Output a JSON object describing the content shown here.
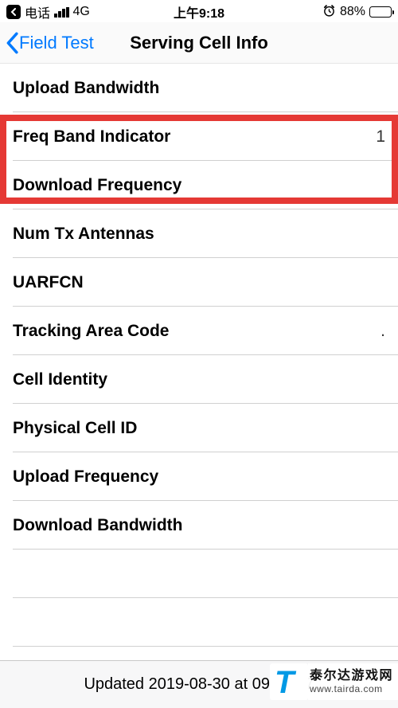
{
  "status": {
    "carrier": "电话",
    "network": "4G",
    "time": "上午9:18",
    "battery_pct": "88%"
  },
  "nav": {
    "back_label": "Field Test",
    "title": "Serving Cell Info"
  },
  "rows": [
    {
      "label": "Upload Bandwidth",
      "value": ""
    },
    {
      "label": "Freq Band Indicator",
      "value": "1"
    },
    {
      "label": "Download Frequency",
      "value": ""
    },
    {
      "label": "Num Tx Antennas",
      "value": ""
    },
    {
      "label": "UARFCN",
      "value": ""
    },
    {
      "label": "Tracking Area Code",
      "value": "."
    },
    {
      "label": "Cell Identity",
      "value": ""
    },
    {
      "label": "Physical Cell ID",
      "value": ""
    },
    {
      "label": "Upload Frequency",
      "value": ""
    },
    {
      "label": "Download Bandwidth",
      "value": ""
    },
    {
      "label": "",
      "value": ""
    },
    {
      "label": "",
      "value": ""
    }
  ],
  "footer": {
    "updated": "Updated 2019-08-30 at 09:17:47"
  },
  "watermark": {
    "name": "泰尔达游戏网",
    "url": "www.tairda.com"
  }
}
